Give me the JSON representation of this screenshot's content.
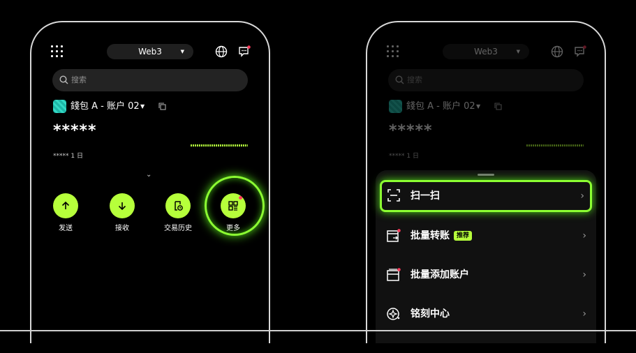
{
  "left": {
    "network": "Web3",
    "search_placeholder": "搜索",
    "wallet_name": "錢包 A - 账户 02",
    "balance_masked": "*****",
    "change_text": "***** 1 日",
    "actions": [
      {
        "label": "发送",
        "icon": "arrow-up-icon"
      },
      {
        "label": "接收",
        "icon": "arrow-down-icon"
      },
      {
        "label": "交易历史",
        "icon": "history-icon"
      },
      {
        "label": "更多",
        "icon": "more-apps-icon"
      }
    ]
  },
  "right": {
    "network": "Web3",
    "search_placeholder": "搜索",
    "wallet_name": "錢包 A - 账户 02",
    "balance_masked": "*****",
    "change_text": "***** 1 日",
    "menu": [
      {
        "label": "扫一扫",
        "icon": "scan-icon"
      },
      {
        "label": "批量转账",
        "icon": "batch-transfer-icon",
        "tag": "推荐"
      },
      {
        "label": "批量添加账户",
        "icon": "batch-add-account-icon"
      },
      {
        "label": "铭刻中心",
        "icon": "inscription-icon"
      }
    ]
  },
  "colors": {
    "accent": "#b6ff3b",
    "highlight": "#8cff32",
    "notification": "#ff3b5c"
  }
}
